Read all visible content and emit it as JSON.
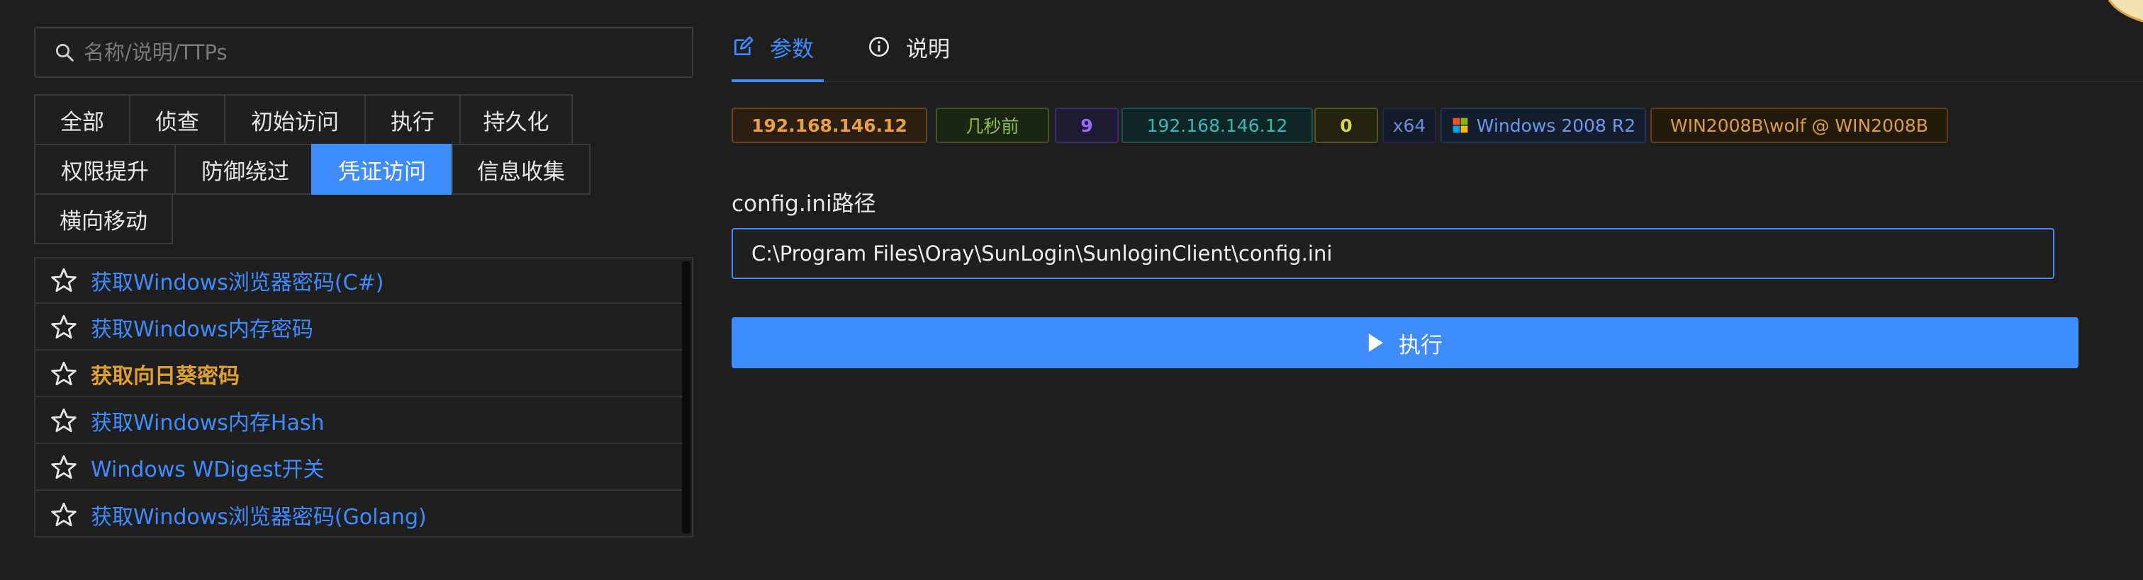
{
  "search": {
    "placeholder": "名称/说明/TTPs"
  },
  "categories": [
    {
      "label": "全部"
    },
    {
      "label": "侦查"
    },
    {
      "label": "初始访问"
    },
    {
      "label": "执行"
    },
    {
      "label": "持久化"
    },
    {
      "label": "权限提升"
    },
    {
      "label": "防御绕过"
    },
    {
      "label": "凭证访问"
    },
    {
      "label": "信息收集"
    },
    {
      "label": "横向移动"
    }
  ],
  "active_category": "凭证访问",
  "modules": [
    {
      "label": "获取Windows浏览器密码(C#)"
    },
    {
      "label": "获取Windows内存密码"
    },
    {
      "label": "获取向日葵密码"
    },
    {
      "label": "获取Windows内存Hash"
    },
    {
      "label": "Windows WDigest开关"
    },
    {
      "label": "获取Windows浏览器密码(Golang)"
    }
  ],
  "highlighted_module": "获取向日葵密码",
  "tabs": [
    {
      "label": "参数",
      "icon": "edit-icon"
    },
    {
      "label": "说明",
      "icon": "info-icon"
    }
  ],
  "active_tab": "参数",
  "session": {
    "host": "192.168.146.12",
    "last_seen": "几秒前",
    "sleep": "9",
    "ip": "192.168.146.12",
    "pid": "0",
    "arch": "x64",
    "os": "Windows 2008 R2",
    "user": "WIN2008B\\wolf @ WIN2008B"
  },
  "form": {
    "field_label": "config.ini路径",
    "field_value": "C:\\Program Files\\Oray\\SunLogin\\SunloginClient\\config.ini"
  },
  "execute_label": "执行",
  "colors": {
    "accent": "#3f8cff",
    "highlight": "#e0a030",
    "host_badge": "#e8a040",
    "time_badge": "#8fbf4f",
    "sleep_badge": "#9b6bff",
    "ip_badge": "#35b8b8",
    "pid_badge": "#d8d840"
  }
}
